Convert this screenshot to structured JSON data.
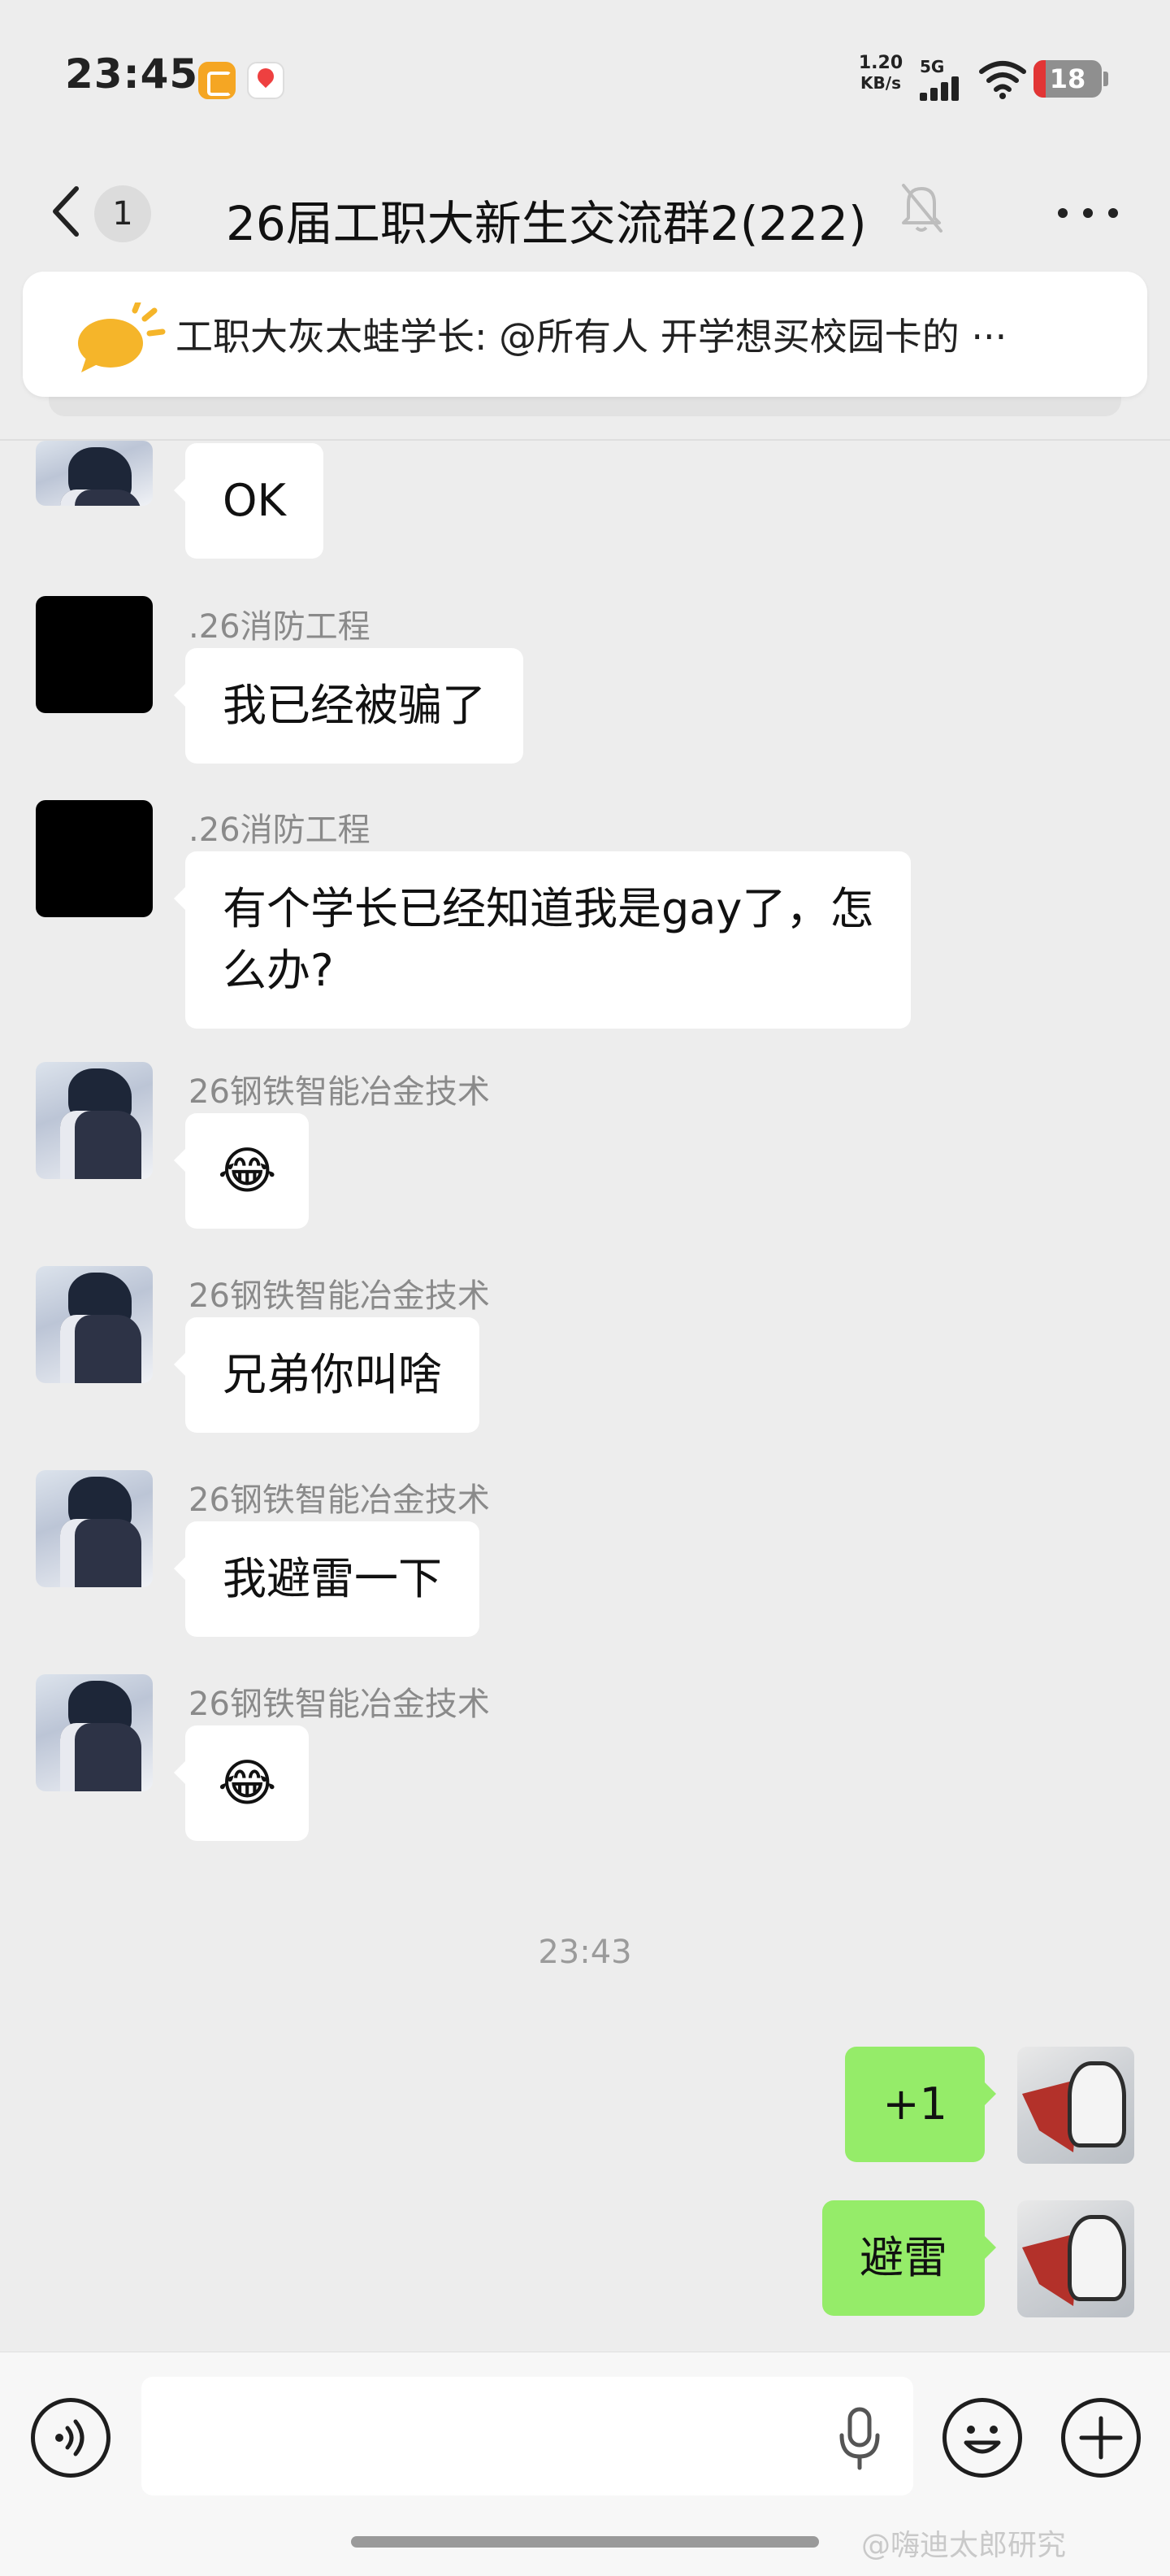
{
  "status_bar": {
    "time": "23:45",
    "net_speed_value": "1.20",
    "net_speed_unit": "KB/s",
    "network": "5G",
    "battery": "18",
    "battery_level": 0.18,
    "icons": [
      "orange-app-icon",
      "map-pin-app-icon",
      "signal-icon",
      "wifi-icon",
      "battery-icon"
    ]
  },
  "header": {
    "back_icon": "chevron-left-icon",
    "unread_count": "1",
    "title": "26届工职大新生交流群2(222)",
    "mute_icon": "bell-off-icon",
    "more_icon": "ellipsis-icon"
  },
  "pinned": {
    "icon": "megaphone-icon",
    "text": "工职大灰太蛙学长: @所有人 开学想买校园卡的 ···"
  },
  "messages": [
    {
      "side": "left",
      "sender": "",
      "text": "OK"
    },
    {
      "side": "left",
      "sender": ".26消防工程",
      "text": "我已经被骗了"
    },
    {
      "side": "left",
      "sender": ".26消防工程",
      "text_line1": "有个学长已经知道我是gay了，怎",
      "text_line2": "么办?"
    },
    {
      "side": "left",
      "sender": "26钢铁智能冶金技术",
      "text": "😂"
    },
    {
      "side": "left",
      "sender": "26钢铁智能冶金技术",
      "text": "兄弟你叫啥"
    },
    {
      "side": "left",
      "sender": "26钢铁智能冶金技术",
      "text": "我避雷一下"
    },
    {
      "side": "left",
      "sender": "26钢铁智能冶金技术",
      "text": "😂"
    },
    {
      "side": "right",
      "sender": "",
      "text": "+1"
    },
    {
      "side": "right",
      "sender": "",
      "text": "避雷"
    }
  ],
  "timestamp": "23:43",
  "input_bar": {
    "voice_icon": "voice-input-icon",
    "text_value": "",
    "mic_icon": "microphone-icon",
    "emoji_icon": "emoji-icon",
    "plus_icon": "plus-icon",
    "watermark": "@嗨迪太郎研究"
  },
  "colors": {
    "background": "#ededed",
    "own_bubble": "#95ec69",
    "other_bubble": "#ffffff",
    "battery_low": "#e23535"
  }
}
